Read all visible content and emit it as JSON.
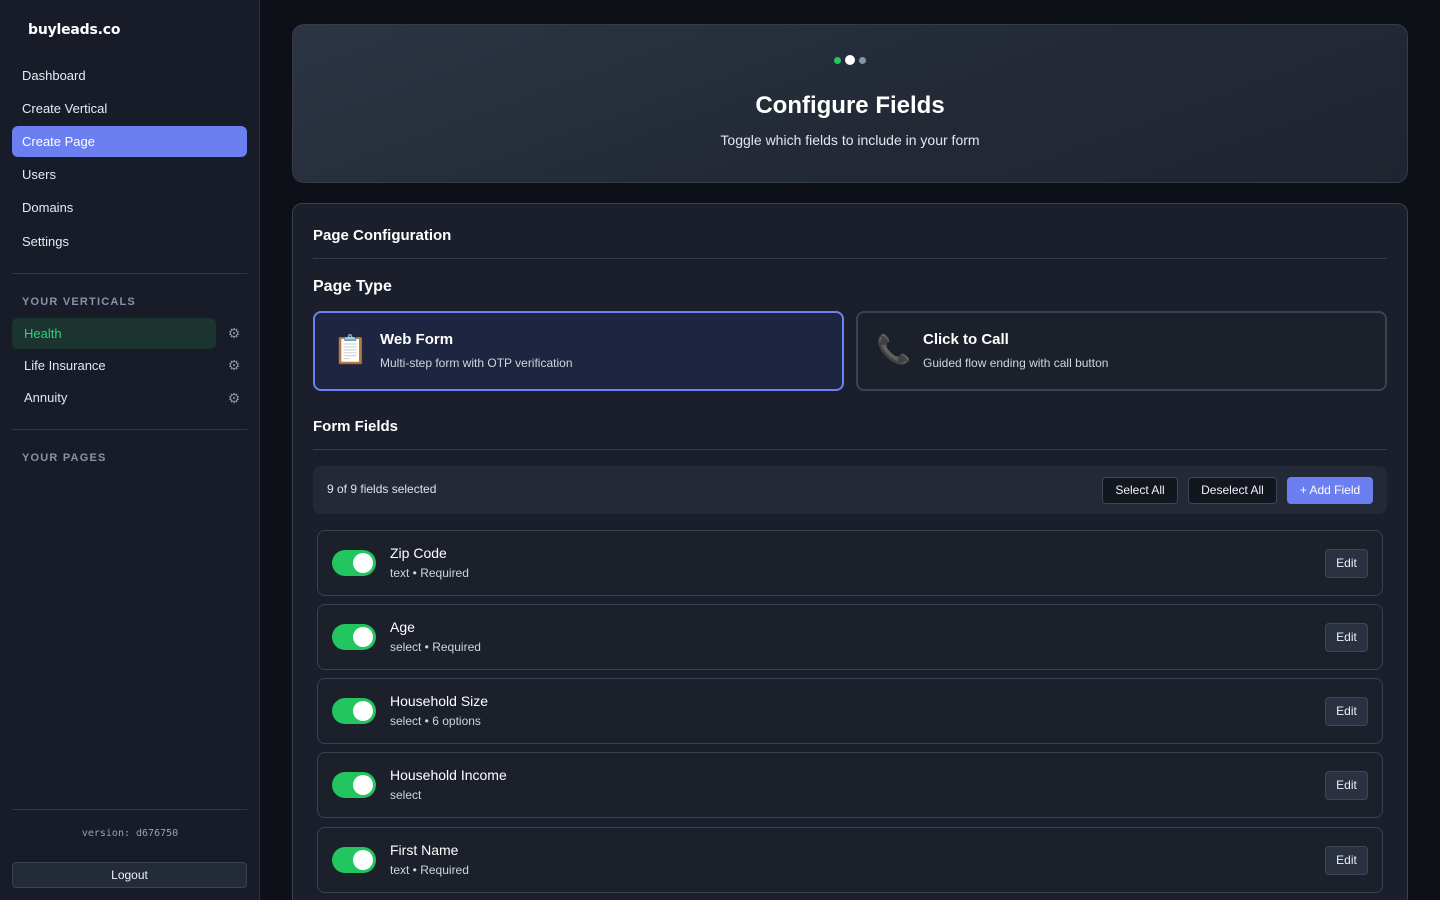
{
  "brand": {
    "logo_text": "buyleads.co"
  },
  "sidebar": {
    "nav": [
      {
        "label": "Dashboard",
        "active": false
      },
      {
        "label": "Create Vertical",
        "active": false
      },
      {
        "label": "Create Page",
        "active": true
      },
      {
        "label": "Users",
        "active": false
      },
      {
        "label": "Domains",
        "active": false
      },
      {
        "label": "Settings",
        "active": false
      }
    ],
    "verticals_heading": "YOUR VERTICALS",
    "verticals": [
      {
        "label": "Health",
        "active": true
      },
      {
        "label": "Life Insurance",
        "active": false
      },
      {
        "label": "Annuity",
        "active": false
      }
    ],
    "pages_heading": "YOUR PAGES",
    "version": "version: d676750",
    "logout_label": "Logout"
  },
  "wizard": {
    "steps_total": 3,
    "current_step": 2,
    "title": "Configure Fields",
    "subtitle": "Toggle which fields to include in your form"
  },
  "config": {
    "heading": "Page Configuration",
    "page_type_heading": "Page Type",
    "page_types": [
      {
        "icon": "clipboard-icon",
        "glyph": "📋",
        "title": "Web Form",
        "description": "Multi-step form with OTP verification",
        "selected": true
      },
      {
        "icon": "phone-icon",
        "glyph": "📞",
        "title": "Click to Call",
        "description": "Guided flow ending with call button",
        "selected": false
      }
    ],
    "form_fields_heading": "Form Fields",
    "selection_count": "9 of 9 fields selected",
    "select_all_label": "Select All",
    "deselect_all_label": "Deselect All",
    "add_field_label": "+ Add Field",
    "edit_label": "Edit",
    "fields": [
      {
        "name": "Zip Code",
        "meta": "text • Required",
        "enabled": true
      },
      {
        "name": "Age",
        "meta": "select • Required",
        "enabled": true
      },
      {
        "name": "Household Size",
        "meta": "select • 6 options",
        "enabled": true
      },
      {
        "name": "Household Income",
        "meta": "select",
        "enabled": true
      },
      {
        "name": "First Name",
        "meta": "text • Required",
        "enabled": true
      }
    ]
  },
  "colors": {
    "accent": "#6b7ff0",
    "toggle_on": "#22c55e",
    "active_vertical_text": "#2fcf86",
    "step_done": "#22c55e",
    "step_current": "#ffffff",
    "step_pending": "#8a93a6"
  }
}
